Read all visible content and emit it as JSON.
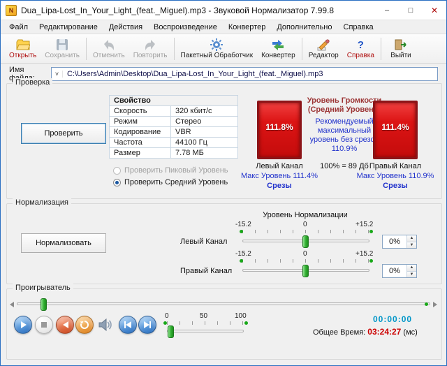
{
  "window": {
    "title": "Dua_Lipa-Lost_In_Your_Light_(feat._Miguel).mp3 - Звуковой Нормализатор 7.99.8",
    "icon_text": "N",
    "minimize": "–",
    "maximize": "□",
    "close": "✕"
  },
  "menu": {
    "items": [
      "Файл",
      "Редактирование",
      "Действия",
      "Воспроизведение",
      "Конвертер",
      "Дополнительно",
      "Справка"
    ]
  },
  "toolbar": {
    "open": "Открыть",
    "save": "Сохранить",
    "undo": "Отменить",
    "redo": "Повторить",
    "batch": "Пакетный Обработчик",
    "converter": "Конвертер",
    "editor": "Редактор",
    "help": "Справка",
    "exit": "Выйти",
    "help_glyph": "?"
  },
  "file": {
    "label": "Имя файла:",
    "chevron": "˅",
    "path": "C:\\Users\\Admin\\Desktop\\Dua_Lipa-Lost_In_Your_Light_(feat._Miguel).mp3"
  },
  "check": {
    "group": "Проверка",
    "button": "Проверить",
    "table": {
      "header": "Свойство",
      "rows": [
        [
          "Скорость",
          "320 кбит/с"
        ],
        [
          "Режим",
          "Стерео"
        ],
        [
          "Кодирование",
          "VBR"
        ],
        [
          "Частота",
          "44100 Гц"
        ],
        [
          "Размер",
          "7.78 МБ"
        ]
      ]
    },
    "radio_peak": "Проверить Пиковый Уровень",
    "radio_avg": "Проверить Средний Уровень",
    "left": {
      "value": "111.8%",
      "channel": "Левый Канал",
      "max": "Макс Уровень 111.4%",
      "clips": "Срезы"
    },
    "right": {
      "value": "111.4%",
      "channel": "Правый Канал",
      "max": "Макс Уровень 110.9%",
      "clips": "Срезы"
    },
    "center": {
      "title1": "Уровень Громкости",
      "title2": "(Средний Уровень)",
      "recommend": "Рекомендуемый максимальный уровень без срезов 110.9%",
      "ref": "100% = 89 Дб"
    }
  },
  "normalize": {
    "group": "Нормализация",
    "button": "Нормализовать",
    "title": "Уровень Нормализации",
    "scale": {
      "min": "-15.2",
      "mid": "0",
      "max": "+15.2"
    },
    "left": {
      "label": "Левый Канал",
      "value": "0%"
    },
    "right": {
      "label": "Правый Канал",
      "value": "0%"
    }
  },
  "player": {
    "group": "Проигрыватель",
    "volume_scale": [
      "0",
      "50",
      "100"
    ],
    "current": "00:00:00",
    "total_label": "Общее Время:",
    "total": "03:24:27",
    "unit": "(мс)"
  },
  "colors": {
    "meter_red": "#d01010",
    "meter_border": "#8c1418",
    "info_blue": "#2233cc",
    "header_maroon": "#9c3434",
    "time_teal": "#0096c8",
    "time_red": "#cc0000",
    "thumb_green": "#2fae2f",
    "window_border_blue": "#2a6fc2"
  }
}
